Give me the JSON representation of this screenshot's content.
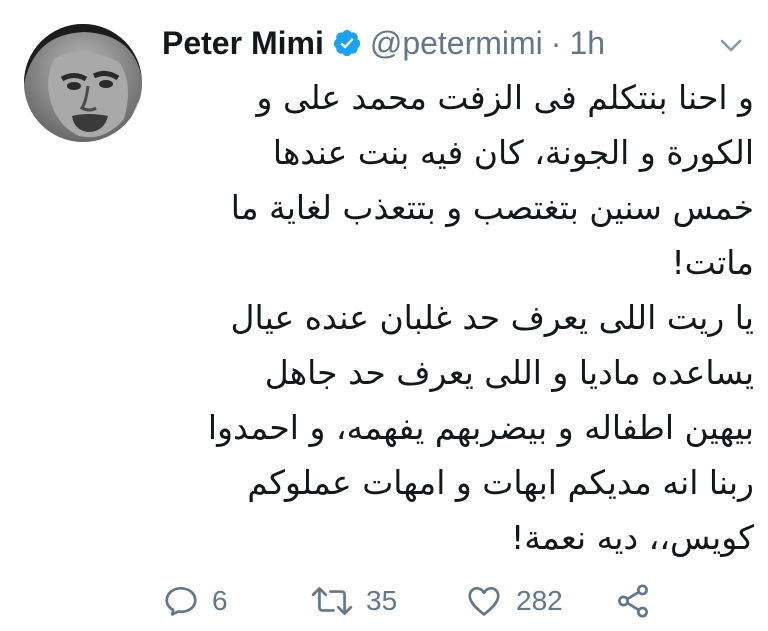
{
  "user": {
    "display_name": "Peter Mimi",
    "handle": "@petermimi",
    "separator": "·",
    "time": "1h",
    "avatar_icon": "avatar",
    "verified_icon": "verified-badge-icon"
  },
  "tweet": {
    "lines": [
      "و احنا بنتكلم فى الزفت محمد على و",
      "الكورة و الجونة، كان فيه بنت عندها",
      "خمس سنين بتغتصب و بتتعذب لغاية ما",
      "ماتت!",
      "يا ريت اللى يعرف حد غلبان عنده عيال",
      "يساعده ماديا و اللى يعرف حد جاهل",
      "بيهين اطفاله و بيضربهم يفهمه، و احمدوا",
      "ربنا انه مديكم ابهات و امهات عملوكم",
      "كويس،، ديه نعمة!"
    ]
  },
  "actions": {
    "reply_count": "6",
    "retweet_count": "35",
    "like_count": "282"
  },
  "colors": {
    "text": "#14171a",
    "muted": "#657786",
    "verified": "#1da1f2"
  }
}
